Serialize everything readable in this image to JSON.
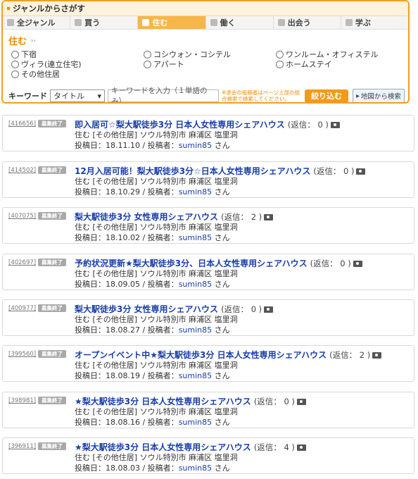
{
  "genre": {
    "heading": "ジャンルからさがす",
    "tabs": [
      {
        "label": "全ジャンル",
        "active": false
      },
      {
        "label": "買う",
        "active": false
      },
      {
        "label": "住む",
        "active": true
      },
      {
        "label": "働く",
        "active": false
      },
      {
        "label": "出会う",
        "active": false
      },
      {
        "label": "学ぶ",
        "active": false
      }
    ],
    "category_title": "住む",
    "options": [
      "下宿",
      "コシウォン・コシテル",
      "ワンルーム・オフィステル",
      "ヴィラ(連立住宅)",
      "アパート",
      "ホームステイ",
      "その他住居"
    ]
  },
  "keyword": {
    "label": "キーワード",
    "select_value": "タイトル",
    "input_placeholder": "キーワードを入力（１単語のみ）",
    "note": "※退会の投稿者はページ上部の総合検索で検索してください。",
    "search_button": "絞り込む",
    "map_button": "地図から検索"
  },
  "posts": [
    {
      "id": "[416656]",
      "badge": "募集終了",
      "title": "即入居可☆梨大駅徒歩3分 日本人女性専用シェアハウス",
      "replies": "(返信： 0 )",
      "category": "住む [その他住居] ソウル特別市 麻浦区 塩里洞",
      "date_prefix": "投稿日：18.11.10 / 投稿者：",
      "user": "sumin85",
      "suffix": " さん"
    },
    {
      "id": "[414502]",
      "badge": "募集終了",
      "title": "12月入居可能！梨大駅徒歩3分☆日本人女性専用シェアハウス",
      "replies": "(返信： 0 )",
      "category": "住む [その他住居] ソウル特別市 麻浦区 塩里洞",
      "date_prefix": "投稿日：18.10.29 / 投稿者：",
      "user": "sumin85",
      "suffix": " さん"
    },
    {
      "id": "[407075]",
      "badge": "募集終了",
      "title": "梨大駅徒歩3分 女性専用シェアハウス",
      "replies": "(返信： 2 )",
      "category": "住む [その他住居] ソウル特別市 麻浦区 塩里洞",
      "date_prefix": "投稿日：18.10.02 / 投稿者：",
      "user": "sumin85",
      "suffix": " さん"
    },
    {
      "id": "[402697]",
      "badge": "募集終了",
      "title": "予約状況更新★梨大駅徒歩3分、日本人女性専用シェアハウス",
      "replies": "(返信： 0 )",
      "category": "住む [その他住居] ソウル特別市 麻浦区 塩里洞",
      "date_prefix": "投稿日：18.09.05 / 投稿者：",
      "user": "sumin85",
      "suffix": " さん"
    },
    {
      "id": "[400977]",
      "badge": "募集終了",
      "title": "梨大駅徒歩3分 女性専用シェアハウス",
      "replies": "(返信： 0 )",
      "category": "住む [その他住居] ソウル特別市 麻浦区 塩里洞",
      "date_prefix": "投稿日：18.08.27 / 投稿者：",
      "user": "sumin85",
      "suffix": " さん"
    },
    {
      "id": "[399560]",
      "badge": "募集終了",
      "title": "オープンイベント中★梨大駅徒歩3分 日本人女性専用シェアハウス",
      "replies": "(返信： 2 )",
      "category": "住む [その他住居] ソウル特別市 麻浦区 塩里洞",
      "date_prefix": "投稿日：18.08.19 / 投稿者：",
      "user": "sumin85",
      "suffix": " さん"
    },
    {
      "id": "[398981]",
      "badge": "募集終了",
      "title": "★梨大駅徒歩3分 日本人女性専用シェアハウス",
      "replies": "(返信： 0 )",
      "category": "住む [その他住居] ソウル特別市 麻浦区 塩里洞",
      "date_prefix": "投稿日：18.08.16 / 投稿者：",
      "user": "sumin85",
      "suffix": " さん"
    },
    {
      "id": "[396911]",
      "badge": "募集終了",
      "title": "★梨大駅徒歩3分 日本人女性専用シェアハウス",
      "replies": "(返信： 4 )",
      "category": "住む [その他住居] ソウル特別市 麻浦区 塩里洞",
      "date_prefix": "投稿日：18.08.03 / 投稿者：",
      "user": "sumin85",
      "suffix": " さん"
    }
  ]
}
